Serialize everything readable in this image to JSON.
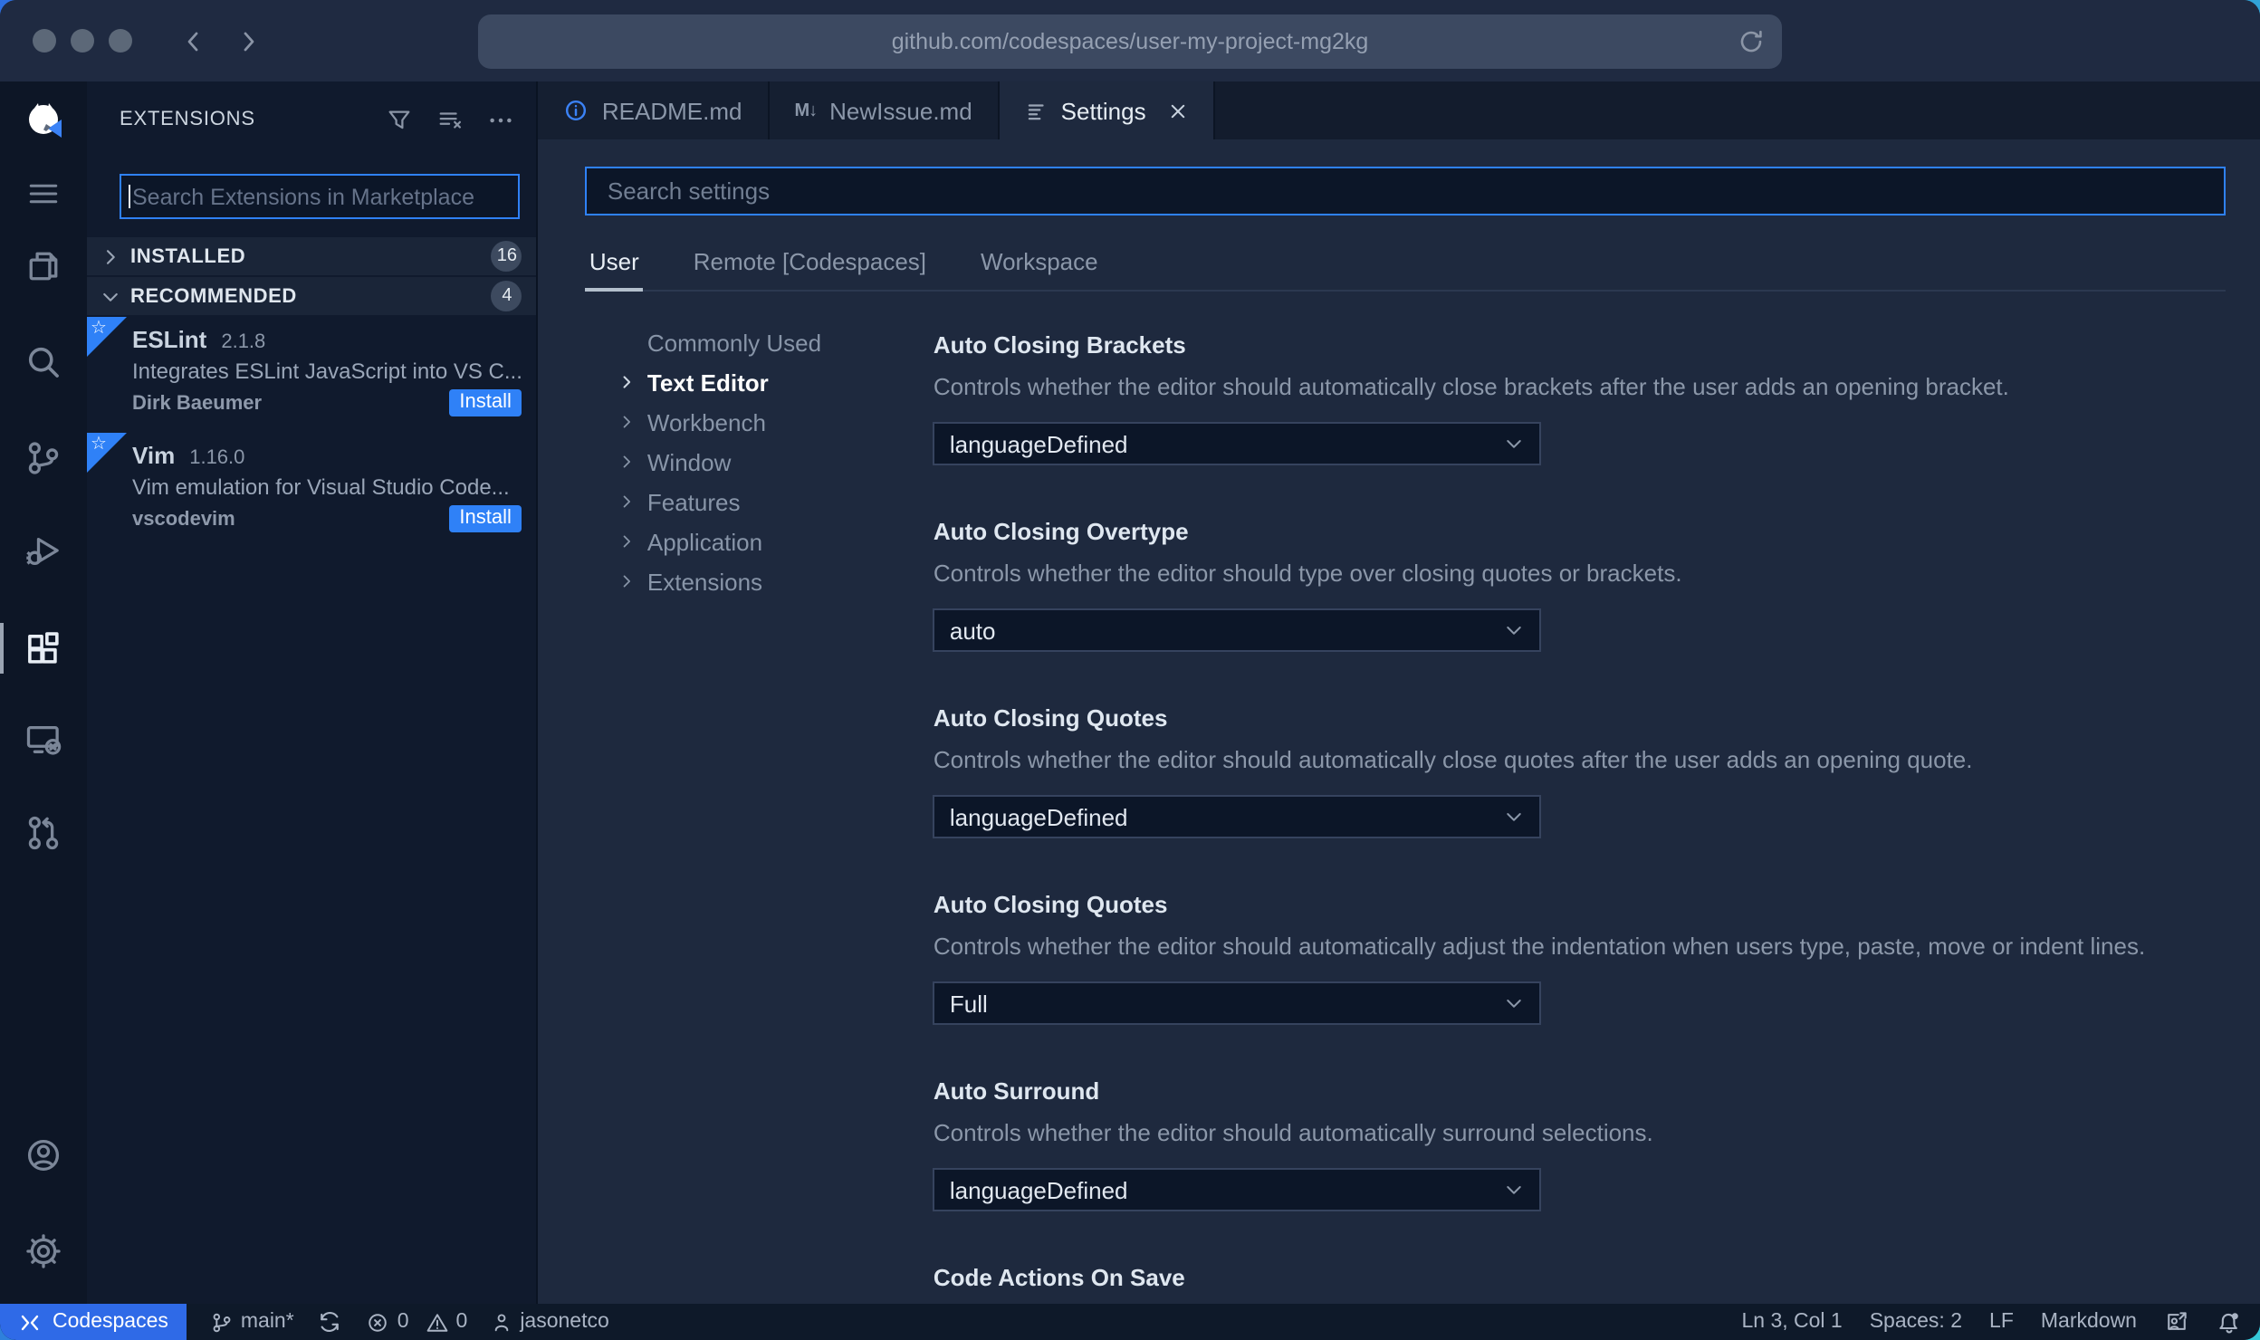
{
  "browser": {
    "url": "github.com/codespaces/user-my-project-mg2kg"
  },
  "editor_tabs": [
    {
      "label": "README.md"
    },
    {
      "label": "NewIssue.md"
    },
    {
      "label": "Settings"
    }
  ],
  "sidebar": {
    "title": "EXTENSIONS",
    "search_placeholder": "Search Extensions in Marketplace",
    "sections": [
      {
        "label": "INSTALLED",
        "count": "16"
      },
      {
        "label": "RECOMMENDED",
        "count": "4"
      }
    ],
    "extensions": [
      {
        "name": "ESLint",
        "version": "2.1.8",
        "description": "Integrates ESLint JavaScript into VS C...",
        "publisher": "Dirk Baeumer",
        "action": "Install"
      },
      {
        "name": "Vim",
        "version": "1.16.0",
        "description": "Vim emulation for Visual Studio Code...",
        "publisher": "vscodevim",
        "action": "Install"
      }
    ]
  },
  "settings": {
    "search_placeholder": "Search settings",
    "scope_tabs": [
      {
        "label": "User"
      },
      {
        "label": "Remote [Codespaces]"
      },
      {
        "label": "Workspace"
      }
    ],
    "toc": [
      {
        "label": "Commonly Used"
      },
      {
        "label": "Text Editor"
      },
      {
        "label": "Workbench"
      },
      {
        "label": "Window"
      },
      {
        "label": "Features"
      },
      {
        "label": "Application"
      },
      {
        "label": "Extensions"
      }
    ],
    "entries": [
      {
        "title": "Auto Closing Brackets",
        "description": "Controls whether the editor should automatically close brackets after the user adds an opening bracket.",
        "value": "languageDefined"
      },
      {
        "title": "Auto Closing Overtype",
        "description": "Controls whether the editor should type over closing quotes or brackets.",
        "value": "auto"
      },
      {
        "title": "Auto Closing Quotes",
        "description": "Controls whether the editor should automatically close quotes after the user adds an opening quote.",
        "value": "languageDefined"
      },
      {
        "title": "Auto Closing Quotes",
        "description": "Controls whether the editor should automatically adjust the indentation when users type, paste, move or indent lines.",
        "value": "Full"
      },
      {
        "title": "Auto Surround",
        "description": "Controls whether the editor should automatically surround selections.",
        "value": "languageDefined"
      },
      {
        "title": "Code Actions On Save",
        "description": "",
        "value": ""
      }
    ]
  },
  "status_bar": {
    "codespaces": "Codespaces",
    "branch": "main*",
    "errors": "0",
    "warnings": "0",
    "user": "jasonetco",
    "line_col": "Ln 3, Col 1",
    "indent": "Spaces: 2",
    "eol": "LF",
    "language": "Markdown"
  },
  "colors": {
    "accent_blue": "#2f81f7",
    "codespaces_blue": "#2f6ae7",
    "editor_bg": "#1e293e",
    "sidebar_bg": "#101a2d"
  },
  "icons": [
    "back-icon",
    "forward-icon",
    "reload-icon",
    "info-icon",
    "markdown-icon",
    "settings-editor-icon",
    "close-icon",
    "filter-icon",
    "clear-list-icon",
    "ellipsis-icon",
    "chevron-right-icon",
    "chevron-down-icon",
    "star-icon",
    "github-codespaces-logo",
    "menu-icon",
    "explorer-icon",
    "search-icon",
    "source-control-icon",
    "run-debug-icon",
    "extensions-icon",
    "remote-explorer-icon",
    "pull-request-icon",
    "account-icon",
    "gear-icon",
    "remote-icon",
    "branch-icon",
    "sync-icon",
    "error-icon",
    "warning-icon",
    "person-icon",
    "feedback-icon",
    "bell-icon"
  ]
}
